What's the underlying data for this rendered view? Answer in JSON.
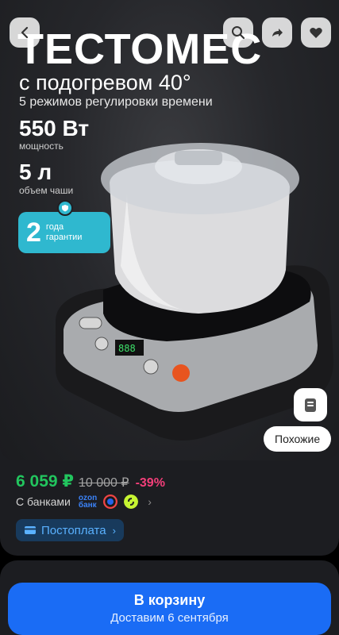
{
  "banner": {
    "title": "ТЕСТОМЕС",
    "subtitle": "с подогревом 40°",
    "modes": "5 режимов регулировки времени",
    "power_value": "550 Вт",
    "power_label": "мощность",
    "volume_value": "5 л",
    "volume_label": "объем чаши",
    "warranty_number": "2",
    "warranty_line1": "года",
    "warranty_line2": "гарантии"
  },
  "top_actions": {
    "icons": [
      "back-icon",
      "search-icon",
      "share-icon",
      "heart-icon"
    ]
  },
  "gallery_actions": {
    "similar_label": "Похожие",
    "side_icon": "catalog-icon"
  },
  "price": {
    "current": "6 059 ₽",
    "old": "10 000 ₽",
    "discount": "-39%",
    "current_color": "#22c55e",
    "discount_color": "#f43f7a"
  },
  "banks": {
    "label": "С банками",
    "ozon_line1": "ozon",
    "ozon_line2": "банк"
  },
  "postpay": {
    "label": "Постоплата"
  },
  "cart": {
    "label": "В корзину",
    "delivery": "Доставим 6 сентября",
    "color": "#1a6cf5"
  }
}
